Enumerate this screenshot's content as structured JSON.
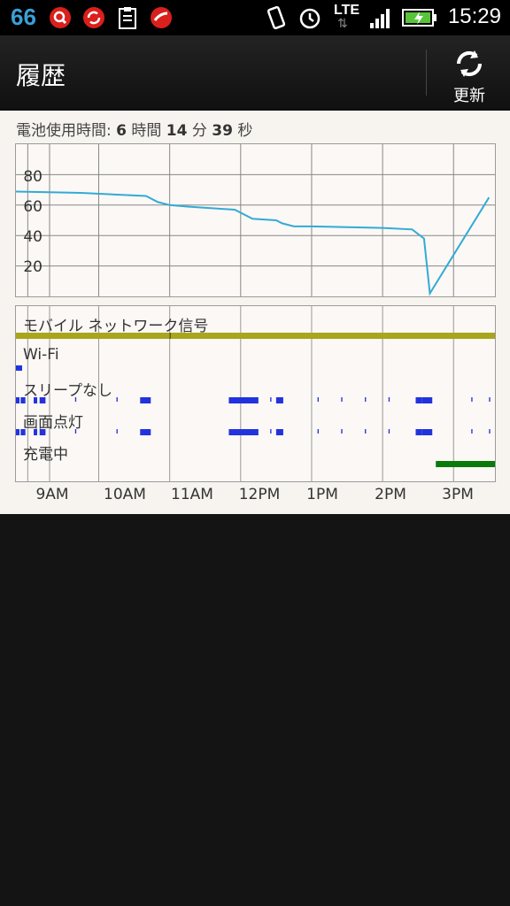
{
  "status": {
    "notification_count": "66",
    "time": "15:29",
    "network_label": "LTE",
    "icons": [
      "search-app-icon",
      "sync-icon",
      "clipboard-icon",
      "trend-micro-icon",
      "vibrate-icon",
      "alarm-icon",
      "lte-icon",
      "signal-icon",
      "battery-charging-icon"
    ]
  },
  "header": {
    "title": "履歴",
    "refresh_label": "更新"
  },
  "usage": {
    "prefix": "電池使用時間: ",
    "hours": "6",
    "hours_unit": " 時間 ",
    "minutes": "14",
    "minutes_unit": " 分 ",
    "seconds": "39",
    "seconds_unit": " 秒"
  },
  "colors": {
    "battery_line": "#33aad6",
    "network_signal": "#a9a51c",
    "activity": "#2233dd",
    "charging": "#0a7a0a"
  },
  "chart_data": {
    "type": "line",
    "title": "",
    "xlabel": "",
    "ylabel": "",
    "x_tick_labels": [
      "9AM",
      "10AM",
      "11AM",
      "12PM",
      "1PM",
      "2PM",
      "3PM"
    ],
    "y_tick_labels": [
      "80",
      "60",
      "40",
      "20"
    ],
    "ylim": [
      0,
      100
    ],
    "series": [
      {
        "x": [
          "08:45",
          "09:45",
          "10:40",
          "10:50",
          "11:00",
          "11:15",
          "11:55",
          "12:10",
          "12:30",
          "12:35",
          "12:45",
          "13:00",
          "14:00",
          "14:25",
          "14:35",
          "14:40",
          "15:30"
        ],
        "values": [
          69,
          68,
          66,
          62,
          60,
          59,
          57,
          51,
          50,
          48,
          46,
          46,
          45,
          44,
          38,
          2,
          65
        ]
      }
    ],
    "grid": true
  },
  "activity": {
    "rows": [
      {
        "label": "モバイル ネットワーク信号"
      },
      {
        "label": "Wi-Fi"
      },
      {
        "label": "スリープなし"
      },
      {
        "label": "画面点灯"
      },
      {
        "label": "充電中"
      }
    ]
  }
}
